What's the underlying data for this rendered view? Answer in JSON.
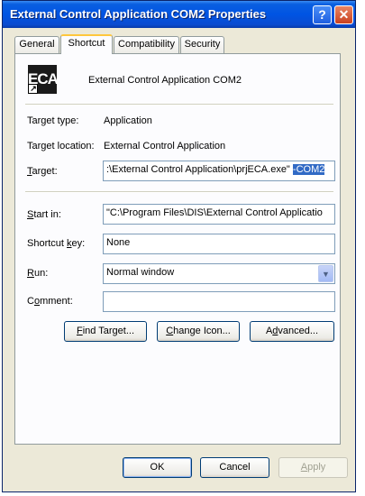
{
  "window": {
    "title": "External Control Application COM2 Properties",
    "help_glyph": "?",
    "close_glyph": "✕"
  },
  "tabs": [
    {
      "label": "General"
    },
    {
      "label": "Shortcut"
    },
    {
      "label": "Compatibility"
    },
    {
      "label": "Security"
    }
  ],
  "active_tab": "Shortcut",
  "app": {
    "icon_text": "ECA",
    "name": "External Control Application COM2"
  },
  "target_type": {
    "label": "Target type:",
    "value": "Application"
  },
  "target_location": {
    "label": "Target location:",
    "value": "External Control Application"
  },
  "target": {
    "label_pre": "",
    "label_key": "T",
    "label_post": "arget:",
    "value": ":\\External Control Application\\prjECA.exe\" ",
    "selected": "-COM2"
  },
  "start_in": {
    "label_key": "S",
    "label_post": "tart in:",
    "value": "\"C:\\Program Files\\DIS\\External Control Applicatio"
  },
  "shortcut_key": {
    "label_pre": "Shortcut ",
    "label_key": "k",
    "label_post": "ey:",
    "value": "None"
  },
  "run": {
    "label_key": "R",
    "label_post": "un:",
    "value": "Normal window"
  },
  "comment": {
    "label_pre": "C",
    "label_key": "o",
    "label_post": "mment:",
    "value": ""
  },
  "buttons": {
    "find_target": {
      "key": "F",
      "rest": "ind Target..."
    },
    "change_icon": {
      "key": "C",
      "rest": "hange Icon..."
    },
    "advanced": {
      "pre": "A",
      "key": "d",
      "rest": "vanced..."
    }
  },
  "footer": {
    "ok": "OK",
    "cancel": "Cancel",
    "apply_key": "A",
    "apply_rest": "pply"
  },
  "colors": {
    "titlebar": "#0054e3",
    "selection": "#316ac5",
    "face": "#ece9d8"
  }
}
